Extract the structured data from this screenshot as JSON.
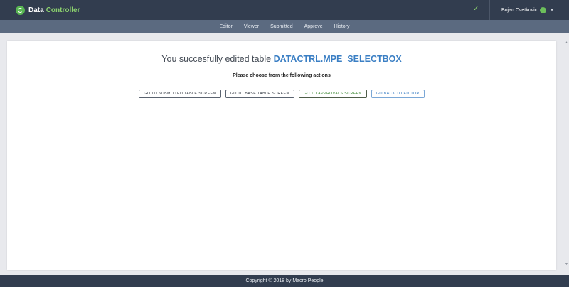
{
  "header": {
    "brand_part1": "Data",
    "brand_part2": "Controller",
    "status_icon": "check-icon",
    "user_name": "Bojan Cvetkovic",
    "user_caret": "▾"
  },
  "nav": {
    "items": [
      {
        "label": "Editor"
      },
      {
        "label": "Viewer"
      },
      {
        "label": "Submitted"
      },
      {
        "label": "Approve"
      },
      {
        "label": "History"
      }
    ]
  },
  "main": {
    "headline_prefix": "You succesfully edited table ",
    "table_name": "DATACTRL.MPE_SELECTBOX",
    "subheading": "Please choose from the following actions",
    "buttons": {
      "submitted": "GO TO SUBMITTED TABLE SCREEN",
      "base": "GO TO BASE TABLE SCREEN",
      "approvals": "GO TO APPROVALS SCREEN",
      "editor": "GO BACK TO EDITOR"
    }
  },
  "colors": {
    "header_bg": "#323d4f",
    "subnav_bg": "#5b6a80",
    "accent_green": "#58b552",
    "accent_blue": "#3b7fc4"
  },
  "footer": {
    "text": "Copyright © 2018 by Macro People"
  }
}
